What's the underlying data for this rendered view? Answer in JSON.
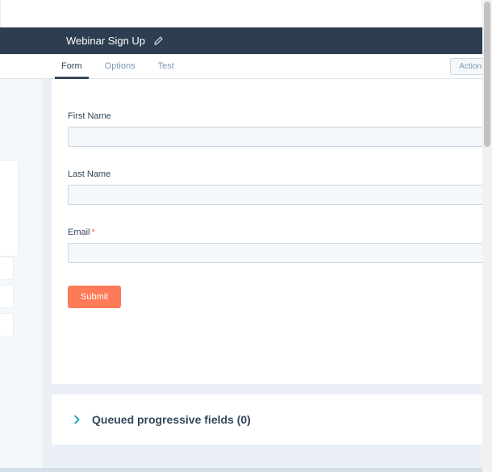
{
  "header": {
    "title": "Webinar Sign Up"
  },
  "tabs": [
    {
      "label": "Form",
      "active": true
    },
    {
      "label": "Options",
      "active": false
    },
    {
      "label": "Test",
      "active": false
    }
  ],
  "actions_label": "Actions",
  "form": {
    "fields": [
      {
        "label": "First Name",
        "required": false,
        "value": ""
      },
      {
        "label": "Last Name",
        "required": false,
        "value": ""
      },
      {
        "label": "Email",
        "required": true,
        "value": ""
      }
    ],
    "submit_label": "Submit"
  },
  "queued": {
    "label": "Queued progressive fields (0)"
  }
}
